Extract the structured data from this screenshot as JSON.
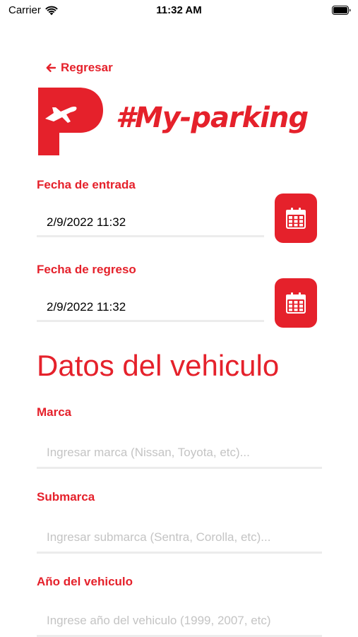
{
  "status_bar": {
    "carrier": "Carrier",
    "time": "11:32 AM"
  },
  "header": {
    "back_label": "Regresar",
    "logo_text": "#My-parking"
  },
  "dates": {
    "entry_label": "Fecha de entrada",
    "entry_value": "2/9/2022 11:32",
    "return_label": "Fecha de regreso",
    "return_value": "2/9/2022 11:32"
  },
  "vehicle": {
    "section_title": "Datos del vehiculo",
    "brand_label": "Marca",
    "brand_placeholder": "Ingresar marca (Nissan, Toyota, etc)...",
    "submodel_label": "Submarca",
    "submodel_placeholder": "Ingresar submarca (Sentra, Corolla, etc)...",
    "year_label": "Año del vehiculo",
    "year_placeholder": "Ingrese año del vehiculo (1999, 2007, etc)"
  },
  "colors": {
    "accent": "#e5212b",
    "divider": "#ececec",
    "placeholder": "#c4c4c4"
  },
  "icons": [
    "wifi-icon",
    "battery-icon",
    "back-arrow-icon",
    "calendar-icon"
  ]
}
